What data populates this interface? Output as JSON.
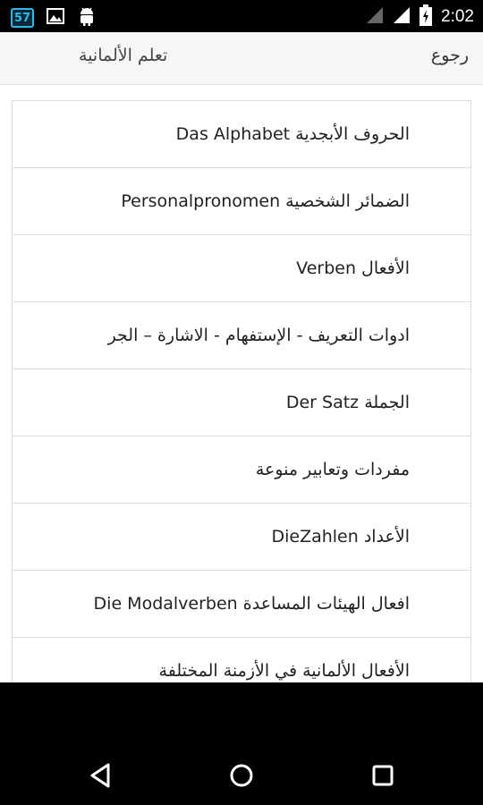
{
  "status_bar": {
    "notification_count": "57",
    "time": "2:02",
    "icons": [
      "notification-count-icon",
      "image-icon",
      "android-icon",
      "wifi-icon",
      "signal-icon",
      "battery-charging-icon"
    ]
  },
  "header": {
    "back_label": "رجوع",
    "title": "تعلم الألمانية"
  },
  "menu": {
    "items": [
      "الحروف الأبجدية Das Alphabet",
      "الضمائر الشخصية Personalpronomen",
      "الأفعال Verben",
      "ادوات التعريف - الإستفهام - الاشارة – الجر",
      "الجملة Der Satz",
      "مفردات وتعابير منوعة",
      "الأعداد DieZahlen",
      "افعال الهيئات المساعدة Die Modalverben",
      "الأفعال الألمانية في الأزمنة المختلفة"
    ]
  },
  "nav_bar": {
    "icons": [
      "back-triangle-icon",
      "home-circle-icon",
      "recents-square-icon"
    ]
  }
}
